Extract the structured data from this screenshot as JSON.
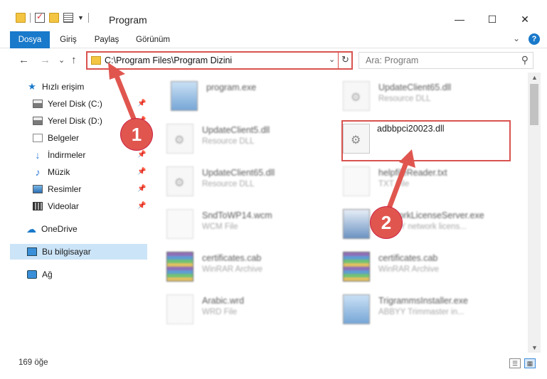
{
  "window": {
    "title": "Program",
    "minimize": "—",
    "maximize": "☐",
    "close": "✕"
  },
  "ribbon": {
    "tabs": [
      "Dosya",
      "Giriş",
      "Paylaş",
      "Görünüm"
    ],
    "expand": "⌄",
    "help": "?"
  },
  "nav": {
    "back": "←",
    "forward": "→",
    "recent": "⌄",
    "up": "↑",
    "address": "C:\\Program Files\\Program Dizini",
    "dropdown": "⌄",
    "refresh": "↻",
    "search_placeholder": "Ara: Program",
    "search_icon": "⚲"
  },
  "sidebar": {
    "items": [
      {
        "label": "Hızlı erişim",
        "icon": "star-icon",
        "pinned": false
      },
      {
        "label": "Yerel Disk (C:)",
        "icon": "drive-icon",
        "pinned": true
      },
      {
        "label": "Yerel Disk (D:)",
        "icon": "drive-icon",
        "pinned": true
      },
      {
        "label": "Belgeler",
        "icon": "documents-icon",
        "pinned": true
      },
      {
        "label": "İndirmeler",
        "icon": "download-icon",
        "pinned": true
      },
      {
        "label": "Müzik",
        "icon": "music-icon",
        "pinned": true
      },
      {
        "label": "Resimler",
        "icon": "pictures-icon",
        "pinned": true
      },
      {
        "label": "Videolar",
        "icon": "videos-icon",
        "pinned": true
      },
      {
        "label": "OneDrive",
        "icon": "cloud-icon",
        "pinned": false
      },
      {
        "label": "Bu bilgisayar",
        "icon": "computer-icon",
        "pinned": false
      },
      {
        "label": "Ağ",
        "icon": "network-icon",
        "pinned": false
      }
    ],
    "pin_glyph": "📌"
  },
  "files": [
    {
      "name": "program.exe",
      "sub": "",
      "icon": "exe-icon"
    },
    {
      "name": "UpdateClient65.dll",
      "sub": "Resource DLL",
      "icon": "dll-icon"
    },
    {
      "name": "UpdateClient5.dll",
      "sub": "Resource DLL",
      "icon": "dll-icon"
    },
    {
      "name": "adbbpci20023.dll",
      "sub": "",
      "icon": "dll-icon"
    },
    {
      "name": "UpdateClient65.dll",
      "sub": "Resource DLL",
      "icon": "dll-icon"
    },
    {
      "name": "helpfileReader.txt",
      "sub": "TXT File",
      "icon": "text-file-icon"
    },
    {
      "name": "SndToWP14.wcm",
      "sub": "WCM File",
      "icon": "plain-file-icon"
    },
    {
      "name": "NetworkLicenseServer.exe",
      "sub": "ABBYY network licens...",
      "icon": "exe-icon"
    },
    {
      "name": "certificates.cab",
      "sub": "WinRAR Archive",
      "icon": "rar-icon"
    },
    {
      "name": "certificates.cab",
      "sub": "WinRAR Archive",
      "icon": "rar-icon"
    },
    {
      "name": "Arabic.wrd",
      "sub": "WRD File",
      "icon": "plain-file-icon"
    },
    {
      "name": "TrigrammsInstaller.exe",
      "sub": "ABBYY Trimmaster in...",
      "icon": "exe-icon"
    }
  ],
  "annotations": {
    "marker1": "1",
    "marker2": "2",
    "accent": "#e0564f"
  },
  "status": {
    "count": "169 öğe"
  },
  "colors": {
    "ribbon_active": "#1979ca",
    "selection": "#cce4f7",
    "highlight": "#d9534f"
  }
}
